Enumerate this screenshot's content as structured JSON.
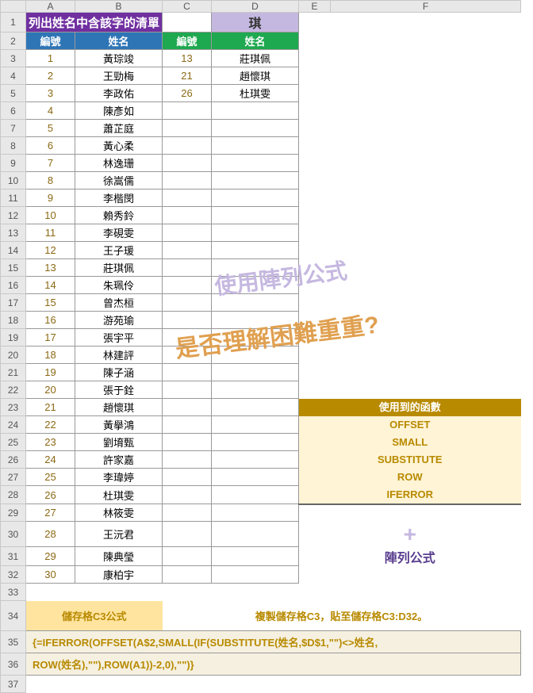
{
  "cols": [
    "A",
    "B",
    "C",
    "D",
    "E",
    "F"
  ],
  "title_row": {
    "ab": "列出姓名中含該字的清單",
    "d": "琪"
  },
  "hdr": {
    "a": "編號",
    "b": "姓名",
    "c": "編號",
    "d": "姓名"
  },
  "data_ab": [
    {
      "n": "1",
      "name": "黃琮竣"
    },
    {
      "n": "2",
      "name": "王勁梅"
    },
    {
      "n": "3",
      "name": "李政佑"
    },
    {
      "n": "4",
      "name": "陳彥如"
    },
    {
      "n": "5",
      "name": "蕭芷庭"
    },
    {
      "n": "6",
      "name": "黃心柔"
    },
    {
      "n": "7",
      "name": "林逸珊"
    },
    {
      "n": "8",
      "name": "徐嵩儒"
    },
    {
      "n": "9",
      "name": "李楷閔"
    },
    {
      "n": "10",
      "name": "賴秀鈴"
    },
    {
      "n": "11",
      "name": "李硯雯"
    },
    {
      "n": "12",
      "name": "王子瑗"
    },
    {
      "n": "13",
      "name": "莊琪佩"
    },
    {
      "n": "14",
      "name": "朱珮伶"
    },
    {
      "n": "15",
      "name": "曾杰桓"
    },
    {
      "n": "16",
      "name": "游苑瑜"
    },
    {
      "n": "17",
      "name": "張宇平"
    },
    {
      "n": "18",
      "name": "林建評"
    },
    {
      "n": "19",
      "name": "陳子涵"
    },
    {
      "n": "20",
      "name": "張于銓"
    },
    {
      "n": "21",
      "name": "趙懷琪"
    },
    {
      "n": "22",
      "name": "黃擧鴻"
    },
    {
      "n": "23",
      "name": "劉堉甄"
    },
    {
      "n": "24",
      "name": "許家嘉"
    },
    {
      "n": "25",
      "name": "李瑋婷"
    },
    {
      "n": "26",
      "name": "杜琪雯"
    },
    {
      "n": "27",
      "name": "林筱雯"
    },
    {
      "n": "28",
      "name": "王沅君"
    },
    {
      "n": "29",
      "name": "陳典瑩"
    },
    {
      "n": "30",
      "name": "康柏宇"
    }
  ],
  "data_cd": [
    {
      "n": "13",
      "name": "莊琪佩"
    },
    {
      "n": "21",
      "name": "趙懷琪"
    },
    {
      "n": "26",
      "name": "杜琪雯"
    }
  ],
  "overlay1": "使用陣列公式",
  "overlay2": "是否理解困難重重?",
  "funcbox": {
    "hdr": "使用到的函數",
    "items": [
      "OFFSET",
      "SMALL",
      "SUBSTITUTE",
      "ROW",
      "IFERROR"
    ],
    "plus": "+",
    "arr": "陣列公式"
  },
  "formula_label": "儲存格C3公式",
  "formula_note": "複製儲存格C3，貼至儲存格C3:D32。",
  "formula_line1": "{=IFERROR(OFFSET(A$2,SMALL(IF(SUBSTITUTE(姓名,$D$1,\"\")<>姓名,",
  "formula_line2": "ROW(姓名),\"\"),ROW(A1))-2,0),\"\")}",
  "colw": {
    "A": 62,
    "B": 110,
    "C": 62,
    "D": 110,
    "E": 40,
    "F": 240
  }
}
